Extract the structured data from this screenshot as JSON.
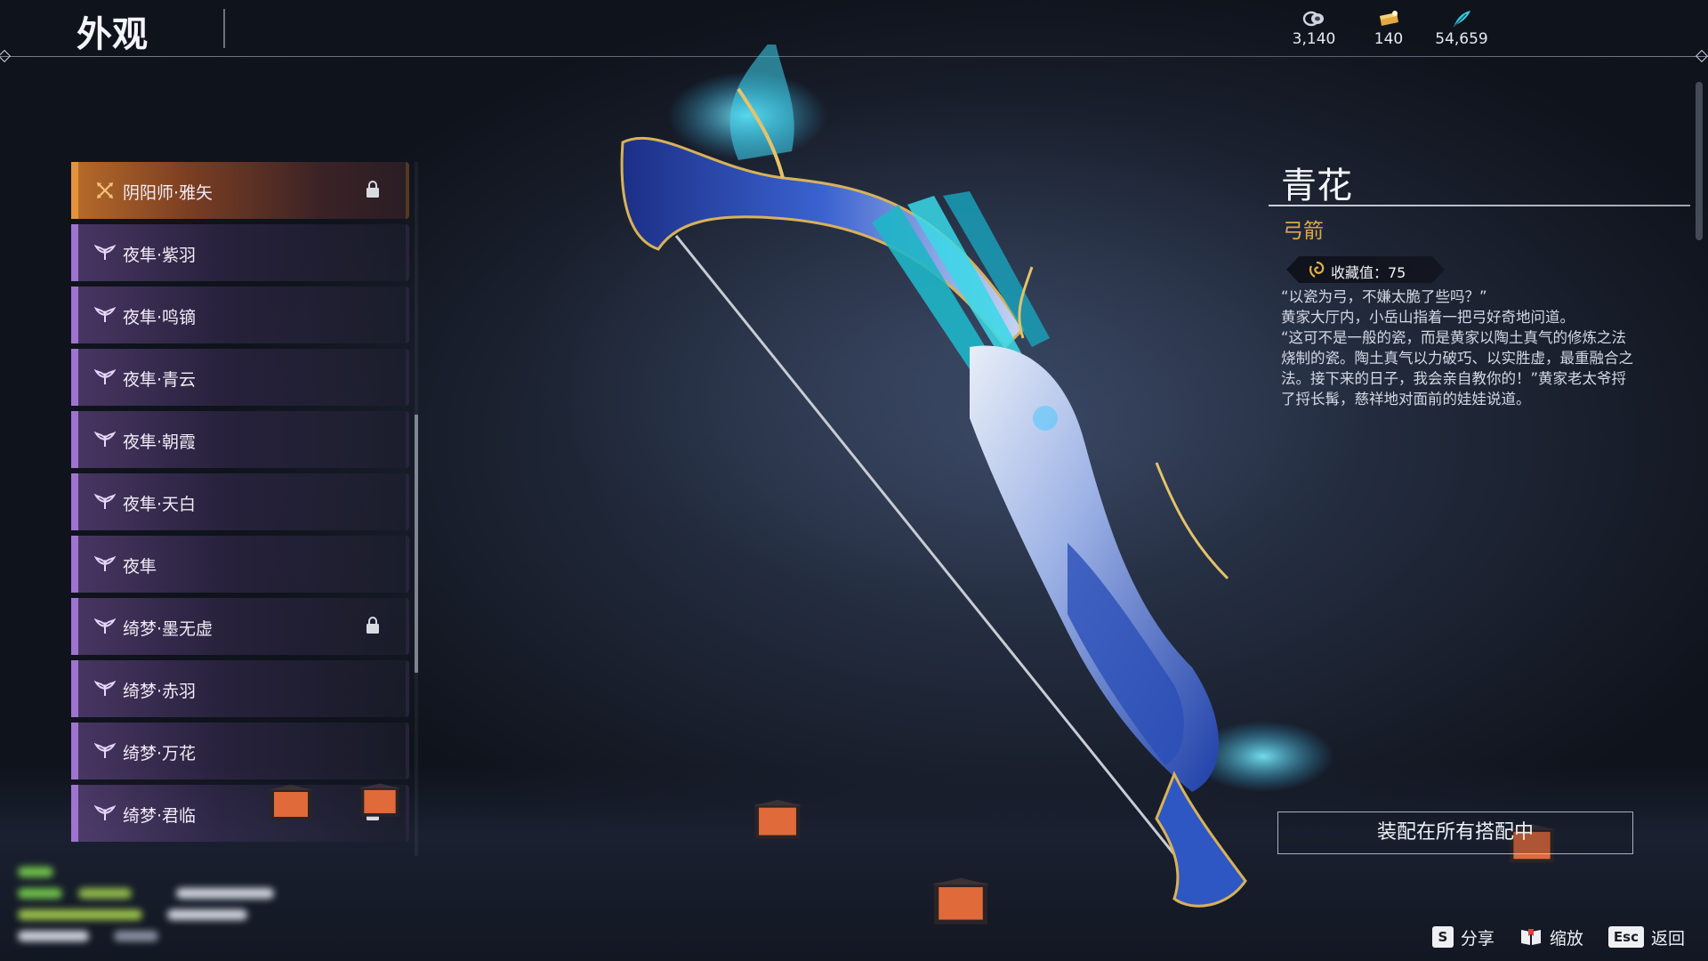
{
  "header": {
    "title": "外观"
  },
  "currencies": [
    {
      "icon": "coin-stack-icon",
      "value": "3,140"
    },
    {
      "icon": "gold-ticket-icon",
      "value": "140"
    },
    {
      "icon": "feather-icon",
      "value": "54,659"
    }
  ],
  "skin_list": {
    "items": [
      {
        "label": "阴阳师·雅矢",
        "icon": "crossed-arrows-icon",
        "locked": true,
        "selected": true
      },
      {
        "label": "夜隼·紫羽",
        "icon": "wings-emblem-icon",
        "locked": false
      },
      {
        "label": "夜隼·鸣镝",
        "icon": "wings-emblem-icon",
        "locked": false
      },
      {
        "label": "夜隼·青云",
        "icon": "wings-emblem-icon",
        "locked": false
      },
      {
        "label": "夜隼·朝霞",
        "icon": "wings-emblem-icon",
        "locked": false
      },
      {
        "label": "夜隼·天白",
        "icon": "wings-emblem-icon",
        "locked": false
      },
      {
        "label": "夜隼",
        "icon": "wings-emblem-icon",
        "locked": false
      },
      {
        "label": "绮梦·墨无虚",
        "icon": "wings-emblem-icon",
        "locked": true
      },
      {
        "label": "绮梦·赤羽",
        "icon": "wings-emblem-icon",
        "locked": false
      },
      {
        "label": "绮梦·万花",
        "icon": "wings-emblem-icon",
        "locked": false
      },
      {
        "label": "绮梦·君临",
        "icon": "wings-emblem-icon",
        "locked": true
      }
    ]
  },
  "detail": {
    "name": "青花",
    "type": "弓箭",
    "collect_label": "收藏值：75",
    "description": [
      "“以瓷为弓，不嫌太脆了些吗？”",
      "黄家大厅内，小岳山指着一把弓好奇地问道。",
      "“这可不是一般的瓷，而是黄家以陶土真气的修炼之法烧制的瓷。陶土真气以力破巧、以实胜虚，最重融合之法。接下来的日子，我会亲自教你的！”黄家老太爷捋了捋长髯，慈祥地对面前的娃娃说道。"
    ],
    "equip_button": "装配在所有搭配中"
  },
  "hints": [
    {
      "key": "S",
      "label": "分享"
    },
    {
      "key": "book-icon",
      "label": "缩放"
    },
    {
      "key": "Esc",
      "label": "返回"
    }
  ],
  "colors": {
    "selected_accent": "#e4933a",
    "item_accent": "#9f74d0",
    "type_gold": "#d9a94a",
    "bow_blue": "#2a4fb8",
    "glow_cyan": "#3fd6f0"
  }
}
